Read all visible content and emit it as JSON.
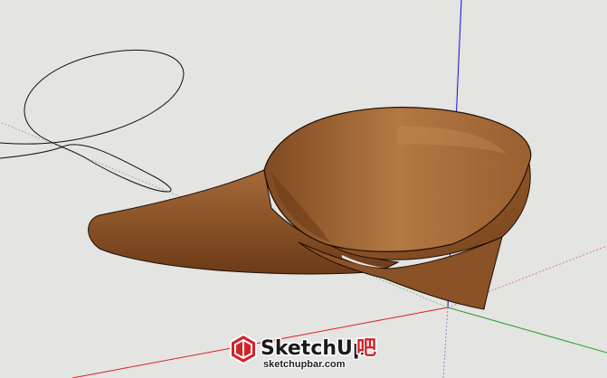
{
  "viewport": {
    "background": "#e4e4e2",
    "axes": {
      "blue": "#1010d8",
      "red": "#d82020",
      "green": "#2aa02a"
    },
    "model": {
      "wood_dark": "#6a3a16",
      "wood_mid": "#93582a",
      "wood_light": "#b57a45",
      "edge": "#1c0f06"
    },
    "sketch_curve_color": "#111111"
  },
  "watermark": {
    "brand": "SketchUp",
    "brand_suffix": "吧",
    "url": "sketchupbar.com",
    "brand_color": "#1a1a1a",
    "accent_color": "#d2232a"
  }
}
